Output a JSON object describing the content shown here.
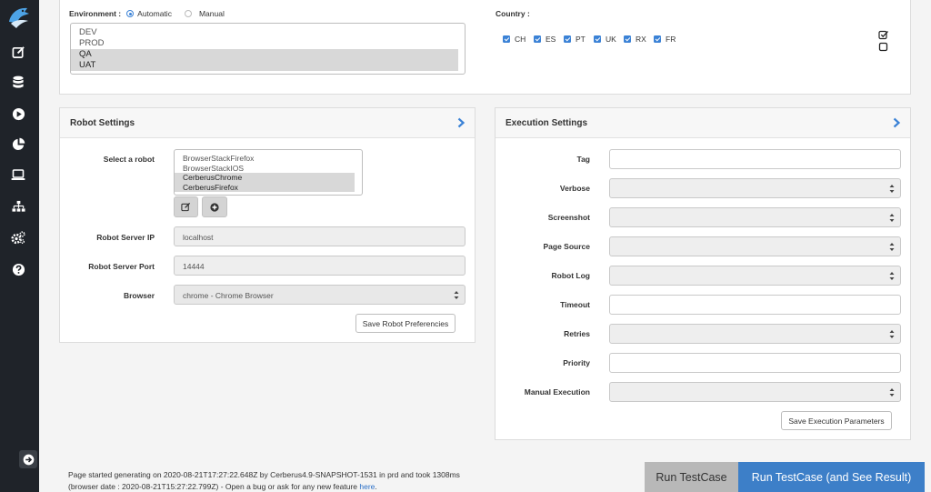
{
  "environment": {
    "label": "Environment :",
    "radio_automatic": "Automatic",
    "radio_manual": "Manual",
    "options": [
      {
        "text": "DEV",
        "selected": false
      },
      {
        "text": "PROD",
        "selected": false
      },
      {
        "text": "QA",
        "selected": true
      },
      {
        "text": "UAT",
        "selected": true
      }
    ]
  },
  "country": {
    "label": "Country :",
    "items": [
      "CH",
      "ES",
      "PT",
      "UK",
      "RX",
      "FR"
    ]
  },
  "robot_settings": {
    "title": "Robot Settings",
    "select_label": "Select a robot",
    "robots": [
      {
        "text": "BrowserStackFirefox",
        "selected": false
      },
      {
        "text": "BrowserStackIOS",
        "selected": false
      },
      {
        "text": "CerberusChrome",
        "selected": true
      },
      {
        "text": "CerberusFirefox",
        "selected": true
      }
    ],
    "server_ip_label": "Robot Server IP",
    "server_ip_value": "localhost",
    "server_port_label": "Robot Server Port",
    "server_port_value": "14444",
    "browser_label": "Browser",
    "browser_value": "chrome - Chrome Browser",
    "save_button": "Save Robot Preferencies"
  },
  "execution_settings": {
    "title": "Execution Settings",
    "fields": [
      {
        "label": "Tag",
        "kind": "input"
      },
      {
        "label": "Verbose",
        "kind": "select"
      },
      {
        "label": "Screenshot",
        "kind": "select"
      },
      {
        "label": "Page Source",
        "kind": "select"
      },
      {
        "label": "Robot Log",
        "kind": "select"
      },
      {
        "label": "Timeout",
        "kind": "input"
      },
      {
        "label": "Retries",
        "kind": "select"
      },
      {
        "label": "Priority",
        "kind": "input"
      },
      {
        "label": "Manual Execution",
        "kind": "select"
      }
    ],
    "save_button": "Save Execution Parameters"
  },
  "footer": {
    "line1": "Page started generating on 2020-08-21T17:27:22.648Z by Cerberus4.9-SNAPSHOT-1531 in prd and took 1308ms",
    "line2_prefix": "(browser date : 2020-08-21T15:27:22.799Z) - Open a bug or ask for any new feature ",
    "line2_link": "here",
    "line2_suffix": "."
  },
  "actions": {
    "run": "Run TestCase",
    "run_see_result": "Run TestCase (and See Result)"
  },
  "colors": {
    "sidebar": "#1f2329",
    "accent": "#3b82d6",
    "run_gray": "#b8b8b8",
    "run_blue": "#3d7fc8"
  }
}
